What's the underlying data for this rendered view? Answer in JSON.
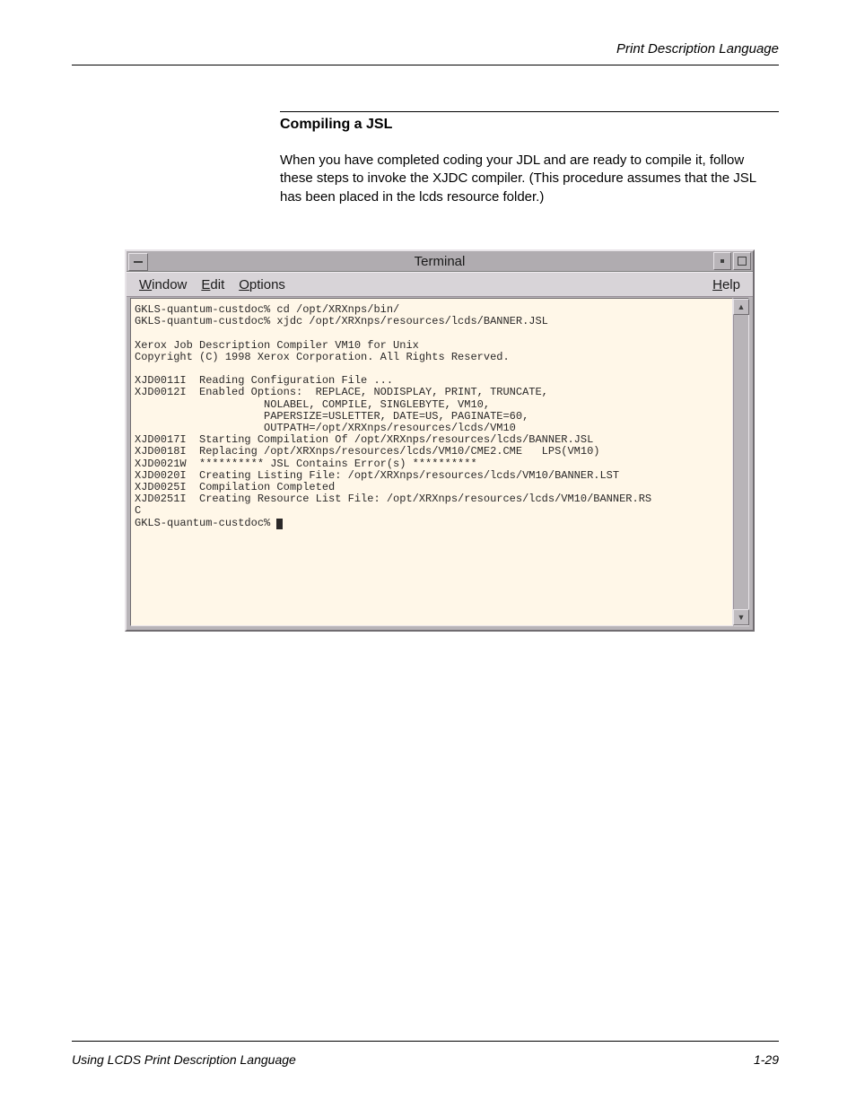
{
  "header": {
    "running_head": "Print Description Language"
  },
  "section": {
    "title": "Compiling a JSL",
    "para": "When you have completed coding your JDL and are ready to compile it, follow these steps to invoke the XJDC compiler. (This procedure assumes that the JSL has been placed in the lcds resource folder.)"
  },
  "terminal": {
    "title": "Terminal",
    "menu": {
      "window": "Window",
      "edit": "Edit",
      "options": "Options",
      "help": "Help"
    },
    "prompt": "GKLS-quantum-custdoc%",
    "lines": [
      "GKLS-quantum-custdoc% cd /opt/XRXnps/bin/",
      "GKLS-quantum-custdoc% xjdc /opt/XRXnps/resources/lcds/BANNER.JSL",
      "",
      "Xerox Job Description Compiler VM10 for Unix",
      "Copyright (C) 1998 Xerox Corporation. All Rights Reserved.",
      "",
      "XJD0011I  Reading Configuration File ...",
      "XJD0012I  Enabled Options:  REPLACE, NODISPLAY, PRINT, TRUNCATE,",
      "                    NOLABEL, COMPILE, SINGLEBYTE, VM10,",
      "                    PAPERSIZE=USLETTER, DATE=US, PAGINATE=60,",
      "                    OUTPATH=/opt/XRXnps/resources/lcds/VM10",
      "XJD0017I  Starting Compilation Of /opt/XRXnps/resources/lcds/BANNER.JSL",
      "XJD0018I  Replacing /opt/XRXnps/resources/lcds/VM10/CME2.CME   LPS(VM10)",
      "XJD0021W  ********** JSL Contains Error(s) **********",
      "XJD0020I  Creating Listing File: /opt/XRXnps/resources/lcds/VM10/BANNER.LST",
      "XJD0025I  Compilation Completed",
      "XJD0251I  Creating Resource List File: /opt/XRXnps/resources/lcds/VM10/BANNER.RS",
      "C"
    ],
    "final_prompt": "GKLS-quantum-custdoc% "
  },
  "footer": {
    "left": "Using LCDS Print Description Language",
    "right": "1-29"
  }
}
